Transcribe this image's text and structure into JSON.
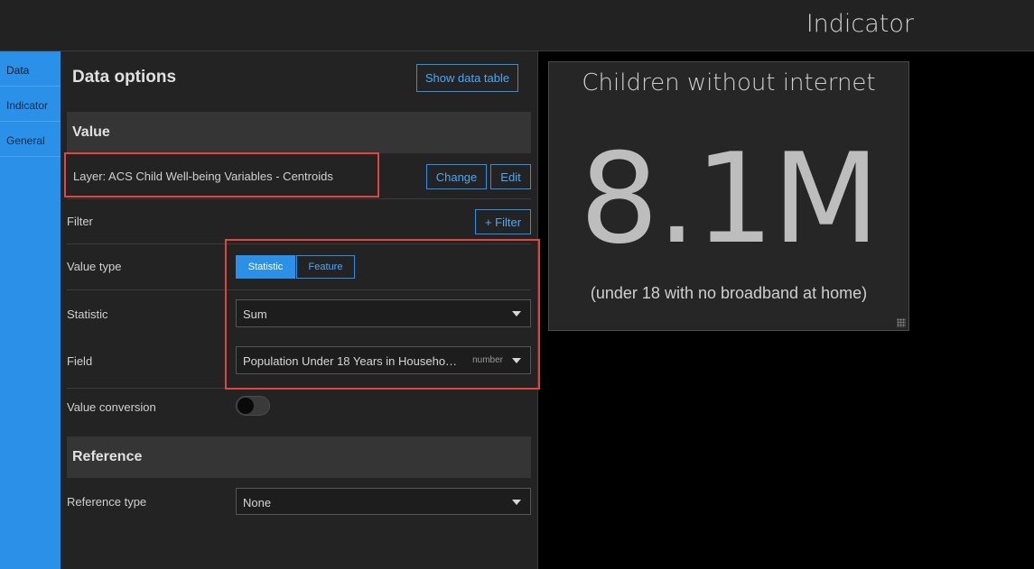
{
  "header": {
    "title": "Indicator"
  },
  "leftnav": {
    "items": [
      {
        "label": "Data"
      },
      {
        "label": "Indicator"
      },
      {
        "label": "General"
      }
    ]
  },
  "data_options": {
    "title": "Data options",
    "show_table_label": "Show data table",
    "value_section": "Value",
    "layer_label": "Layer: ACS Child Well-being Variables - Centroids",
    "change_label": "Change",
    "edit_label": "Edit",
    "filter_label": "Filter",
    "add_filter_label": "+ Filter",
    "value_type_label": "Value type",
    "value_type_options": [
      "Statistic",
      "Feature"
    ],
    "value_type_selected": "Statistic",
    "statistic_label": "Statistic",
    "statistic_value": "Sum",
    "field_label": "Field",
    "field_value": "Population Under 18 Years in Househo…",
    "field_type": "number",
    "value_conversion_label": "Value conversion",
    "value_conversion_on": false,
    "reference_section": "Reference",
    "reference_type_label": "Reference type",
    "reference_type_value": "None"
  },
  "indicator_card": {
    "title": "Children without internet",
    "value": "8.1M",
    "subtitle": "(under 18 with no broadband at home)"
  },
  "colors": {
    "accent": "#2b90e8",
    "highlight": "#e0453f",
    "panel": "#232323",
    "card": "#262626"
  }
}
